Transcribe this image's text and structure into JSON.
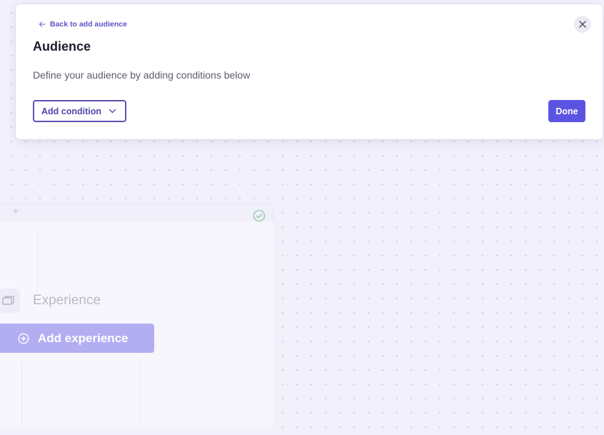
{
  "modal": {
    "back_label": "Back to add audience",
    "title": "Audience",
    "description": "Define your audience by adding conditions below",
    "add_condition_label": "Add condition",
    "done_label": "Done"
  },
  "canvas": {
    "experience_label": "Experience",
    "add_experience_label": "Add experience"
  },
  "colors": {
    "accent": "#5b54e3",
    "outline": "#5a54b4",
    "canvas_bg": "#f1f0fb",
    "add_experience_bg": "#b3aef2",
    "check_green": "#8fc7a4"
  },
  "icons": [
    "arrow-left-icon",
    "close-icon",
    "chevron-down-icon",
    "plus-icon",
    "check-circle-icon",
    "window-icon",
    "plus-circle-icon"
  ]
}
